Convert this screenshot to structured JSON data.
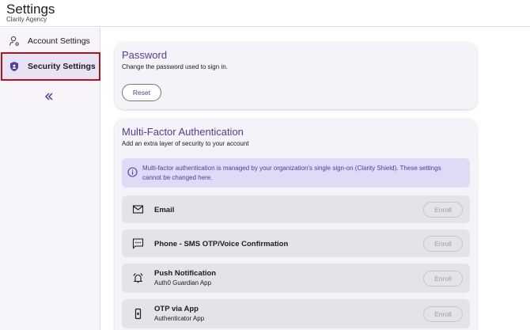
{
  "header": {
    "title": "Settings",
    "subtitle": "Clarity Agency"
  },
  "sidebar": {
    "items": [
      {
        "label": "Account Settings",
        "icon": "account-settings-icon"
      },
      {
        "label": "Security Settings",
        "icon": "shield-icon",
        "selected": true
      }
    ],
    "collapse_icon": "double-chevron-left-icon"
  },
  "password": {
    "title": "Password",
    "description": "Change the password used to sign in.",
    "reset_label": "Reset"
  },
  "mfa": {
    "title": "Multi-Factor Authentication",
    "description": "Add an extra layer of security to your account",
    "info_text": "Multi-factor authentication is managed by your organization's single sign-on (Clarity Shield). These settings cannot be changed here.",
    "methods": [
      {
        "name": "Email",
        "subtitle": "",
        "icon": "mail-icon",
        "enroll_label": "Enroll"
      },
      {
        "name": "Phone - SMS OTP/Voice Confirmation",
        "subtitle": "",
        "icon": "sms-icon",
        "enroll_label": "Enroll"
      },
      {
        "name": "Push Notification",
        "subtitle": "Auth0 Guardian App",
        "icon": "alarm-bell-icon",
        "enroll_label": "Enroll"
      },
      {
        "name": "OTP via App",
        "subtitle": "Authenticator App",
        "icon": "phone-app-icon",
        "enroll_label": "Enroll"
      }
    ]
  },
  "colors": {
    "accent": "#4b3fa0",
    "selected_outline": "#b3121c",
    "info_bg": "#dfdaf5"
  }
}
